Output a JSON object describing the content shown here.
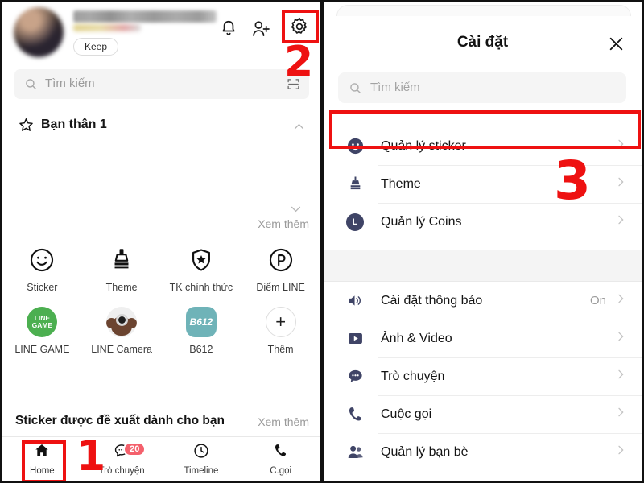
{
  "left_panel": {
    "profile": {
      "avatar": "user-avatar-blurred",
      "name_redacted": "",
      "keep_label": "Keep"
    },
    "header_icons": [
      {
        "name": "bell-icon",
        "label": ""
      },
      {
        "name": "add-friend-icon",
        "label": ""
      },
      {
        "name": "gear-icon",
        "label": ""
      }
    ],
    "search": {
      "placeholder": "Tìm kiếm",
      "icon": "search-icon",
      "trailing_icon": "qr-scan-icon"
    },
    "favorites": {
      "label": "Bạn thân 1",
      "icon": "star-icon",
      "collapse_icon": "chevron-up-icon"
    },
    "see_more_friends": "Xem thêm",
    "app_grid": [
      {
        "label": "Sticker",
        "icon": "smiley-icon"
      },
      {
        "label": "Theme",
        "icon": "brush-icon"
      },
      {
        "label": "TK chính thức",
        "icon": "shield-star-icon"
      },
      {
        "label": "Điểm LINE",
        "icon": "point-p-icon"
      },
      {
        "label": "LINE GAME",
        "icon": "line-game-icon",
        "badge_text": "LINE GAME"
      },
      {
        "label": "LINE Camera",
        "icon": "line-camera-icon"
      },
      {
        "label": "B612",
        "icon": "b612-icon",
        "badge_text": "B612"
      },
      {
        "label": "Thêm",
        "icon": "plus-icon"
      }
    ],
    "sticker_section": {
      "title": "Sticker được đề xuất dành cho bạn",
      "see_more": "Xem thêm"
    },
    "bottom_nav": [
      {
        "label": "Home",
        "icon": "home-icon",
        "badge": ""
      },
      {
        "label": "Trò chuyện",
        "icon": "chat-bubble-icon",
        "badge": "20"
      },
      {
        "label": "Timeline",
        "icon": "clock-icon",
        "badge": ""
      },
      {
        "label": "C.gọi",
        "icon": "phone-icon",
        "badge": ""
      }
    ]
  },
  "right_panel": {
    "title": "Cài đặt",
    "close_icon": "close-icon",
    "search": {
      "placeholder": "Tìm kiếm",
      "icon": "search-icon"
    },
    "group_1": [
      {
        "label": "Quản lý sticker",
        "icon": "smiley-icon",
        "value": "",
        "chevron": "chevron-right-icon"
      },
      {
        "label": "Theme",
        "icon": "brush-icon",
        "value": "",
        "chevron": "chevron-right-icon"
      },
      {
        "label": "Quản lý Coins",
        "icon": "coins-l-icon",
        "value": "",
        "chevron": "chevron-right-icon"
      }
    ],
    "group_2": [
      {
        "label": "Cài đặt thông báo",
        "icon": "speaker-icon",
        "value": "On",
        "chevron": "chevron-right-icon"
      },
      {
        "label": "Ảnh & Video",
        "icon": "video-icon",
        "value": "",
        "chevron": "chevron-right-icon"
      },
      {
        "label": "Trò chuyện",
        "icon": "chat-bubble-icon",
        "value": "",
        "chevron": "chevron-right-icon"
      },
      {
        "label": "Cuộc gọi",
        "icon": "phone-icon",
        "value": "",
        "chevron": "chevron-right-icon"
      },
      {
        "label": "Quản lý bạn bè",
        "icon": "friends-icon",
        "value": "",
        "chevron": "chevron-right-icon"
      }
    ]
  },
  "annotations": [
    {
      "number": "1",
      "target": "home-tab"
    },
    {
      "number": "2",
      "target": "gear-icon"
    },
    {
      "number": "3",
      "target": "manage-sticker-row"
    }
  ],
  "colors": {
    "annotation_red": "#ee1111",
    "settings_icon": "#3f4466",
    "badge_red": "#f4606c",
    "line_game_green": "#4caf50",
    "b612_teal": "#6fb3b8"
  }
}
